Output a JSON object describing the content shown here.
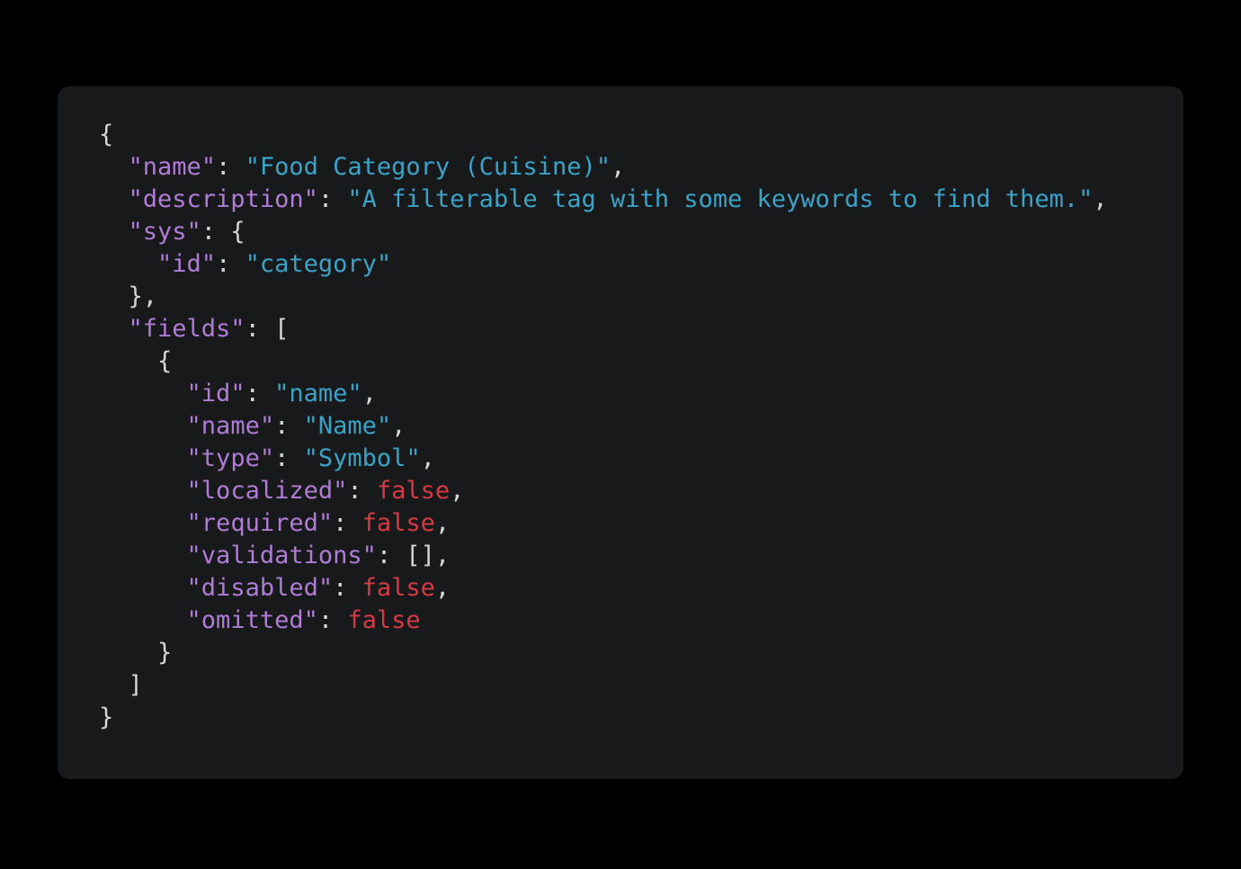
{
  "page": {
    "background_color": "#000000",
    "panel_background_color": "#18191b",
    "language": "json"
  },
  "theme": {
    "punctuation_color": "#d6d6d6",
    "key_color": "#b07cd6",
    "string_color": "#3aa3c7",
    "boolean_color": "#d63a45"
  },
  "code": {
    "lines": [
      {
        "id": "line-1",
        "indent": 0,
        "tokens": [
          {
            "text": "{",
            "type": "punc"
          }
        ]
      },
      {
        "id": "line-2",
        "indent": 2,
        "tokens": [
          {
            "text": "\"name\"",
            "type": "key"
          },
          {
            "text": ": ",
            "type": "punc"
          },
          {
            "text": "\"Food Category (Cuisine)\"",
            "type": "str"
          },
          {
            "text": ",",
            "type": "punc"
          }
        ]
      },
      {
        "id": "line-3",
        "indent": 2,
        "tokens": [
          {
            "text": "\"description\"",
            "type": "key"
          },
          {
            "text": ": ",
            "type": "punc"
          },
          {
            "text": "\"A filterable tag with some keywords to find them.\"",
            "type": "str"
          },
          {
            "text": ",",
            "type": "punc"
          }
        ]
      },
      {
        "id": "line-4",
        "indent": 2,
        "tokens": [
          {
            "text": "\"sys\"",
            "type": "key"
          },
          {
            "text": ": {",
            "type": "punc"
          }
        ]
      },
      {
        "id": "line-5",
        "indent": 4,
        "tokens": [
          {
            "text": "\"id\"",
            "type": "key"
          },
          {
            "text": ": ",
            "type": "punc"
          },
          {
            "text": "\"category\"",
            "type": "str"
          }
        ]
      },
      {
        "id": "line-6",
        "indent": 2,
        "tokens": [
          {
            "text": "},",
            "type": "punc"
          }
        ]
      },
      {
        "id": "line-7",
        "indent": 2,
        "tokens": [
          {
            "text": "\"fields\"",
            "type": "key"
          },
          {
            "text": ": [",
            "type": "punc"
          }
        ]
      },
      {
        "id": "line-8",
        "indent": 4,
        "tokens": [
          {
            "text": "{",
            "type": "punc"
          }
        ]
      },
      {
        "id": "line-9",
        "indent": 6,
        "tokens": [
          {
            "text": "\"id\"",
            "type": "key"
          },
          {
            "text": ": ",
            "type": "punc"
          },
          {
            "text": "\"name\"",
            "type": "str"
          },
          {
            "text": ",",
            "type": "punc"
          }
        ]
      },
      {
        "id": "line-10",
        "indent": 6,
        "tokens": [
          {
            "text": "\"name\"",
            "type": "key"
          },
          {
            "text": ": ",
            "type": "punc"
          },
          {
            "text": "\"Name\"",
            "type": "str"
          },
          {
            "text": ",",
            "type": "punc"
          }
        ]
      },
      {
        "id": "line-11",
        "indent": 6,
        "tokens": [
          {
            "text": "\"type\"",
            "type": "key"
          },
          {
            "text": ": ",
            "type": "punc"
          },
          {
            "text": "\"Symbol\"",
            "type": "str"
          },
          {
            "text": ",",
            "type": "punc"
          }
        ]
      },
      {
        "id": "line-12",
        "indent": 6,
        "tokens": [
          {
            "text": "\"localized\"",
            "type": "key"
          },
          {
            "text": ": ",
            "type": "punc"
          },
          {
            "text": "false",
            "type": "bool"
          },
          {
            "text": ",",
            "type": "punc"
          }
        ]
      },
      {
        "id": "line-13",
        "indent": 6,
        "tokens": [
          {
            "text": "\"required\"",
            "type": "key"
          },
          {
            "text": ": ",
            "type": "punc"
          },
          {
            "text": "false",
            "type": "bool"
          },
          {
            "text": ",",
            "type": "punc"
          }
        ]
      },
      {
        "id": "line-14",
        "indent": 6,
        "tokens": [
          {
            "text": "\"validations\"",
            "type": "key"
          },
          {
            "text": ": [],",
            "type": "punc"
          }
        ]
      },
      {
        "id": "line-15",
        "indent": 6,
        "tokens": [
          {
            "text": "\"disabled\"",
            "type": "key"
          },
          {
            "text": ": ",
            "type": "punc"
          },
          {
            "text": "false",
            "type": "bool"
          },
          {
            "text": ",",
            "type": "punc"
          }
        ]
      },
      {
        "id": "line-16",
        "indent": 6,
        "tokens": [
          {
            "text": "\"omitted\"",
            "type": "key"
          },
          {
            "text": ": ",
            "type": "punc"
          },
          {
            "text": "false",
            "type": "bool"
          }
        ]
      },
      {
        "id": "line-17",
        "indent": 4,
        "tokens": [
          {
            "text": "}",
            "type": "punc"
          }
        ]
      },
      {
        "id": "line-18",
        "indent": 2,
        "tokens": [
          {
            "text": "]",
            "type": "punc"
          }
        ]
      },
      {
        "id": "line-19",
        "indent": 0,
        "tokens": [
          {
            "text": "}",
            "type": "punc"
          }
        ]
      }
    ]
  }
}
